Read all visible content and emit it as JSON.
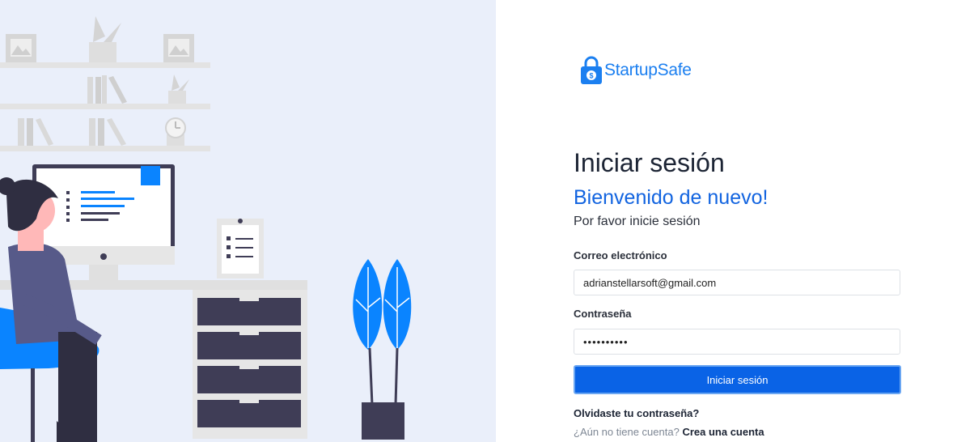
{
  "brand": {
    "name": "StartupSafe",
    "accent_color": "#1b7ff0"
  },
  "login": {
    "title": "Iniciar sesión",
    "welcome": "Bienvenido de nuevo!",
    "subtitle": "Por favor inicie sesión",
    "email_label": "Correo electrónico",
    "email_value": "adrianstellarsoft@gmail.com",
    "password_label": "Contraseña",
    "password_value": "••••••••••",
    "submit_label": "Iniciar sesión",
    "forgot_link": "Olvidaste tu contraseña?",
    "no_account_text": "¿Aún no tiene cuenta?",
    "signup_link": "Crea una cuenta"
  },
  "icons": {
    "logo": "padlock-dollar-icon"
  },
  "colors": {
    "primary_button": "#0a63e6",
    "illustration_bg": "#eaeffa",
    "plant_blue": "#0a84ff"
  }
}
